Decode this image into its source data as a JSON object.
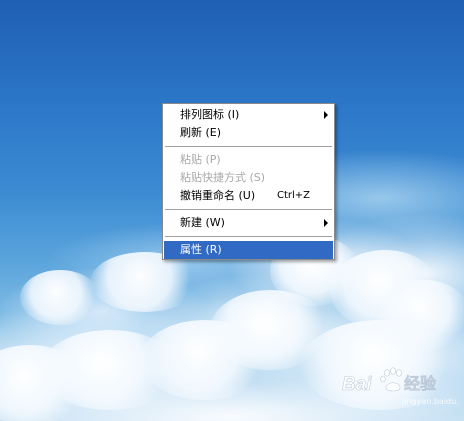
{
  "context_menu": {
    "items": [
      {
        "label": "排列图标 (I)",
        "has_submenu": true,
        "disabled": false
      },
      {
        "label": "刷新 (E)",
        "disabled": false
      },
      {
        "label": "粘贴 (P)",
        "disabled": true
      },
      {
        "label": "粘贴快捷方式 (S)",
        "disabled": true
      },
      {
        "label": "撤销重命名 (U)",
        "shortcut": "Ctrl+Z",
        "disabled": false
      },
      {
        "label": "新建 (W)",
        "has_submenu": true,
        "disabled": false
      },
      {
        "label": "属性 (R)",
        "disabled": false,
        "selected": true
      }
    ],
    "highlight_color": "#316ac5"
  },
  "watermark": {
    "text": "Bai度经验",
    "sub": "jingyan.baidu.com"
  }
}
